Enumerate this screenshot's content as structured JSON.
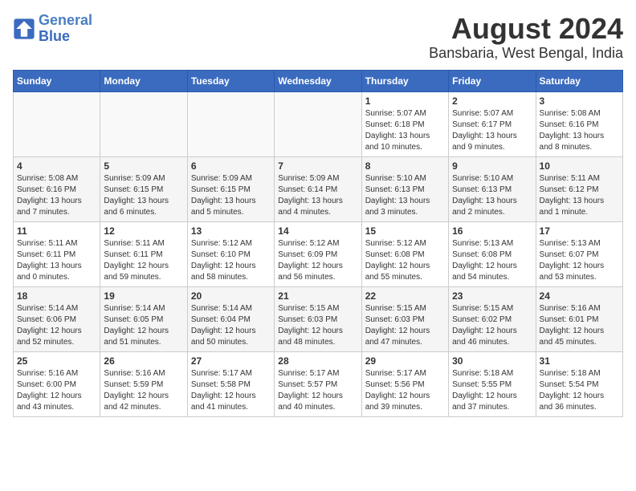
{
  "logo": {
    "line1": "General",
    "line2": "Blue"
  },
  "title": "August 2024",
  "subtitle": "Bansbaria, West Bengal, India",
  "weekdays": [
    "Sunday",
    "Monday",
    "Tuesday",
    "Wednesday",
    "Thursday",
    "Friday",
    "Saturday"
  ],
  "weeks": [
    [
      {
        "day": "",
        "info": ""
      },
      {
        "day": "",
        "info": ""
      },
      {
        "day": "",
        "info": ""
      },
      {
        "day": "",
        "info": ""
      },
      {
        "day": "1",
        "info": "Sunrise: 5:07 AM\nSunset: 6:18 PM\nDaylight: 13 hours\nand 10 minutes."
      },
      {
        "day": "2",
        "info": "Sunrise: 5:07 AM\nSunset: 6:17 PM\nDaylight: 13 hours\nand 9 minutes."
      },
      {
        "day": "3",
        "info": "Sunrise: 5:08 AM\nSunset: 6:16 PM\nDaylight: 13 hours\nand 8 minutes."
      }
    ],
    [
      {
        "day": "4",
        "info": "Sunrise: 5:08 AM\nSunset: 6:16 PM\nDaylight: 13 hours\nand 7 minutes."
      },
      {
        "day": "5",
        "info": "Sunrise: 5:09 AM\nSunset: 6:15 PM\nDaylight: 13 hours\nand 6 minutes."
      },
      {
        "day": "6",
        "info": "Sunrise: 5:09 AM\nSunset: 6:15 PM\nDaylight: 13 hours\nand 5 minutes."
      },
      {
        "day": "7",
        "info": "Sunrise: 5:09 AM\nSunset: 6:14 PM\nDaylight: 13 hours\nand 4 minutes."
      },
      {
        "day": "8",
        "info": "Sunrise: 5:10 AM\nSunset: 6:13 PM\nDaylight: 13 hours\nand 3 minutes."
      },
      {
        "day": "9",
        "info": "Sunrise: 5:10 AM\nSunset: 6:13 PM\nDaylight: 13 hours\nand 2 minutes."
      },
      {
        "day": "10",
        "info": "Sunrise: 5:11 AM\nSunset: 6:12 PM\nDaylight: 13 hours\nand 1 minute."
      }
    ],
    [
      {
        "day": "11",
        "info": "Sunrise: 5:11 AM\nSunset: 6:11 PM\nDaylight: 13 hours\nand 0 minutes."
      },
      {
        "day": "12",
        "info": "Sunrise: 5:11 AM\nSunset: 6:11 PM\nDaylight: 12 hours\nand 59 minutes."
      },
      {
        "day": "13",
        "info": "Sunrise: 5:12 AM\nSunset: 6:10 PM\nDaylight: 12 hours\nand 58 minutes."
      },
      {
        "day": "14",
        "info": "Sunrise: 5:12 AM\nSunset: 6:09 PM\nDaylight: 12 hours\nand 56 minutes."
      },
      {
        "day": "15",
        "info": "Sunrise: 5:12 AM\nSunset: 6:08 PM\nDaylight: 12 hours\nand 55 minutes."
      },
      {
        "day": "16",
        "info": "Sunrise: 5:13 AM\nSunset: 6:08 PM\nDaylight: 12 hours\nand 54 minutes."
      },
      {
        "day": "17",
        "info": "Sunrise: 5:13 AM\nSunset: 6:07 PM\nDaylight: 12 hours\nand 53 minutes."
      }
    ],
    [
      {
        "day": "18",
        "info": "Sunrise: 5:14 AM\nSunset: 6:06 PM\nDaylight: 12 hours\nand 52 minutes."
      },
      {
        "day": "19",
        "info": "Sunrise: 5:14 AM\nSunset: 6:05 PM\nDaylight: 12 hours\nand 51 minutes."
      },
      {
        "day": "20",
        "info": "Sunrise: 5:14 AM\nSunset: 6:04 PM\nDaylight: 12 hours\nand 50 minutes."
      },
      {
        "day": "21",
        "info": "Sunrise: 5:15 AM\nSunset: 6:03 PM\nDaylight: 12 hours\nand 48 minutes."
      },
      {
        "day": "22",
        "info": "Sunrise: 5:15 AM\nSunset: 6:03 PM\nDaylight: 12 hours\nand 47 minutes."
      },
      {
        "day": "23",
        "info": "Sunrise: 5:15 AM\nSunset: 6:02 PM\nDaylight: 12 hours\nand 46 minutes."
      },
      {
        "day": "24",
        "info": "Sunrise: 5:16 AM\nSunset: 6:01 PM\nDaylight: 12 hours\nand 45 minutes."
      }
    ],
    [
      {
        "day": "25",
        "info": "Sunrise: 5:16 AM\nSunset: 6:00 PM\nDaylight: 12 hours\nand 43 minutes."
      },
      {
        "day": "26",
        "info": "Sunrise: 5:16 AM\nSunset: 5:59 PM\nDaylight: 12 hours\nand 42 minutes."
      },
      {
        "day": "27",
        "info": "Sunrise: 5:17 AM\nSunset: 5:58 PM\nDaylight: 12 hours\nand 41 minutes."
      },
      {
        "day": "28",
        "info": "Sunrise: 5:17 AM\nSunset: 5:57 PM\nDaylight: 12 hours\nand 40 minutes."
      },
      {
        "day": "29",
        "info": "Sunrise: 5:17 AM\nSunset: 5:56 PM\nDaylight: 12 hours\nand 39 minutes."
      },
      {
        "day": "30",
        "info": "Sunrise: 5:18 AM\nSunset: 5:55 PM\nDaylight: 12 hours\nand 37 minutes."
      },
      {
        "day": "31",
        "info": "Sunrise: 5:18 AM\nSunset: 5:54 PM\nDaylight: 12 hours\nand 36 minutes."
      }
    ]
  ]
}
